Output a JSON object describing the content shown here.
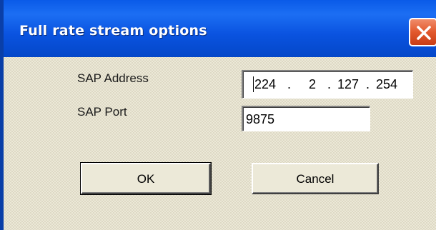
{
  "dialog": {
    "title": "Full rate stream options",
    "close_icon": "close-icon"
  },
  "form": {
    "sap_address_label": "SAP Address",
    "sap_address": {
      "octet1": "224",
      "octet2": "2",
      "octet3": "127",
      "octet4": "254",
      "separator": "."
    },
    "sap_port_label": "SAP Port",
    "sap_port_value": "9875"
  },
  "buttons": {
    "ok_label": "OK",
    "cancel_label": "Cancel"
  },
  "colors": {
    "titlebar": "#0a53e0",
    "close_button": "#e2582c",
    "dialog_face": "#ece9d8"
  }
}
